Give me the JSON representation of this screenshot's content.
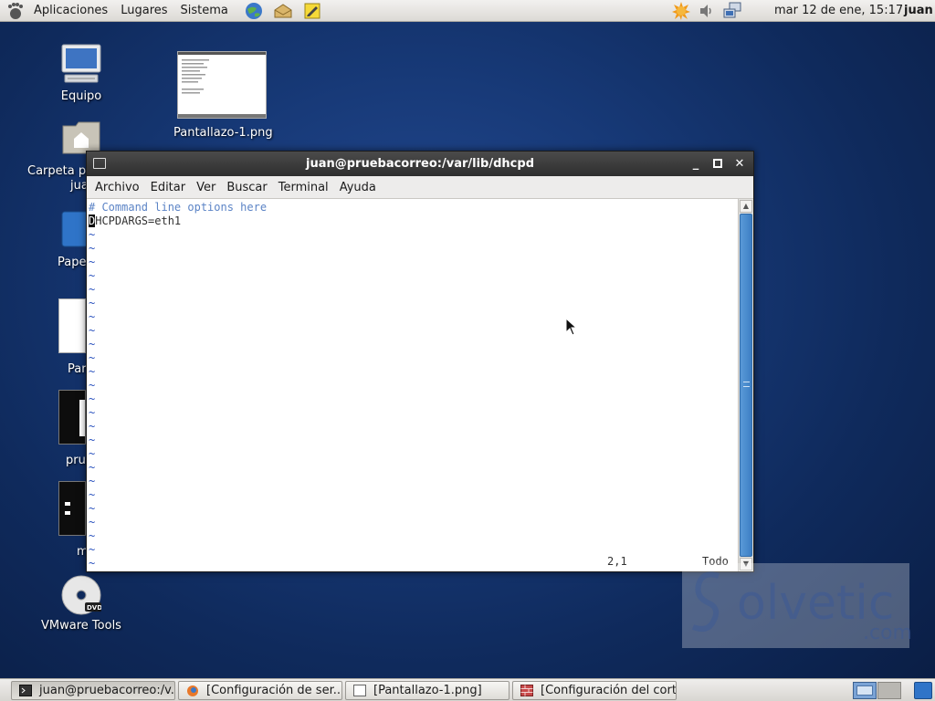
{
  "top_panel": {
    "menus": [
      "Aplicaciones",
      "Lugares",
      "Sistema"
    ],
    "clock": "mar 12 de ene, 15:17",
    "user": "juan",
    "launcher_icons": [
      "browser-globe-icon",
      "mail-icon",
      "notes-icon"
    ],
    "tray_icons": [
      "update-sun-icon",
      "volume-icon",
      "network-icon"
    ]
  },
  "desktop": {
    "icons": [
      {
        "label": "Equipo"
      },
      {
        "label": "Pantallazo-1.png"
      },
      {
        "label": "Carpeta pe"
      },
      {
        "label": "jua"
      },
      {
        "label": "Pape"
      },
      {
        "label": "Par"
      },
      {
        "label": "prue"
      },
      {
        "label": "m"
      },
      {
        "label": "VMware Tools"
      }
    ]
  },
  "terminal": {
    "title": "juan@pruebacorreo:/var/lib/dhcpd",
    "menus": [
      "Archivo",
      "Editar",
      "Ver",
      "Buscar",
      "Terminal",
      "Ayuda"
    ],
    "lines": {
      "comment": "# Command line options here",
      "cursor_char": "D",
      "code_rest": "HCPDARGS=eth1"
    },
    "tilde": "~",
    "tilde_count": 25,
    "status_position": "2,1",
    "status_scope": "Todo"
  },
  "watermark": {
    "text": "olvetic",
    "suffix": ".com"
  },
  "taskbar": {
    "tasks": [
      {
        "label": "juan@pruebacorreo:/v..."
      },
      {
        "label": "[Configuración de ser..."
      },
      {
        "label": "[Pantallazo-1.png]"
      },
      {
        "label": "[Configuración del cort..."
      }
    ]
  },
  "colors": {
    "vim_comment": "#5c84c6",
    "vim_tilde": "#2a52be",
    "scroll_thumb": "#3d7fc4",
    "desktop_bg": "#173977"
  }
}
